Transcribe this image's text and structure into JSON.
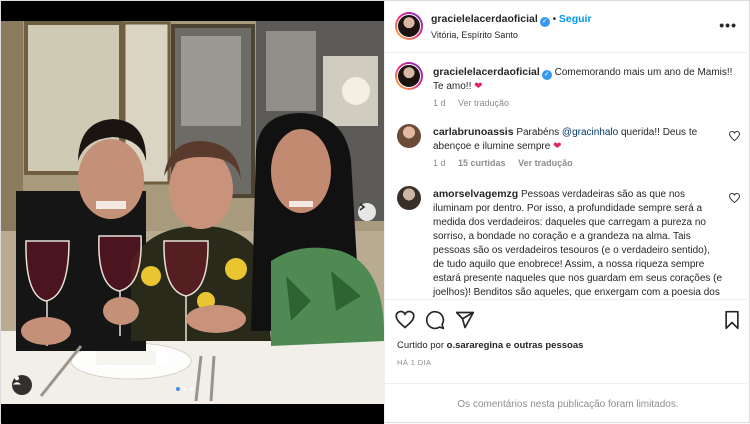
{
  "post": {
    "author": "gracielelacerdaoficial",
    "follow_label": "Seguir",
    "location": "Vitória, Espírito Santo",
    "more_label": "•••",
    "caption": {
      "username": "gracielelacerdaoficial",
      "text": "Comemorando mais um ano de Mamis!! Te amo!!",
      "emoji": "❤",
      "time": "1 d",
      "translate": "Ver tradução"
    },
    "comments": [
      {
        "username": "carlabrunoassis",
        "text_before": "Parabéns",
        "mention": "@gracinhalo",
        "text_after": "querida!! Deus te abençoe e ilumine sempre",
        "emoji": "❤",
        "time": "1 d",
        "likes": "15 curtidas",
        "translate": "Ver tradução"
      },
      {
        "username": "amorselvagemzg",
        "text": "Pessoas verdadeiras são as que nos iluminam por dentro. Por isso, a profundidade sempre será a medida dos verdadeiros: daqueles que carregam a pureza no sorriso, a bondade no coração e a grandeza na alma. Tais pessoas são os verdadeiros tesouros (e o verdadeiro sentido), de tudo aquilo que enobrece! Assim, a nossa riqueza sempre estará presente naqueles que nos guardam em seus corações (e joelhos)! Benditos são aqueles, que enxergam com a poesia dos olhos,"
      }
    ],
    "liked_by_prefix": "Curtido por",
    "liked_by_user": "o.sararegina",
    "liked_by_suffix": "e outras pessoas",
    "posted_ago": "HÁ 1 DIA",
    "comments_limited": "Os comentários nesta publicação foram limitados."
  },
  "colors": {
    "accent": "#0095f6",
    "verified": "#3897f0",
    "heart": "#e0245e",
    "muted": "#8e8e8e"
  },
  "icons": [
    "verified-badge-icon",
    "more-options-icon",
    "heart-icon",
    "comment-icon",
    "share-icon",
    "bookmark-icon",
    "next-arrow-icon",
    "user-tag-icon"
  ]
}
